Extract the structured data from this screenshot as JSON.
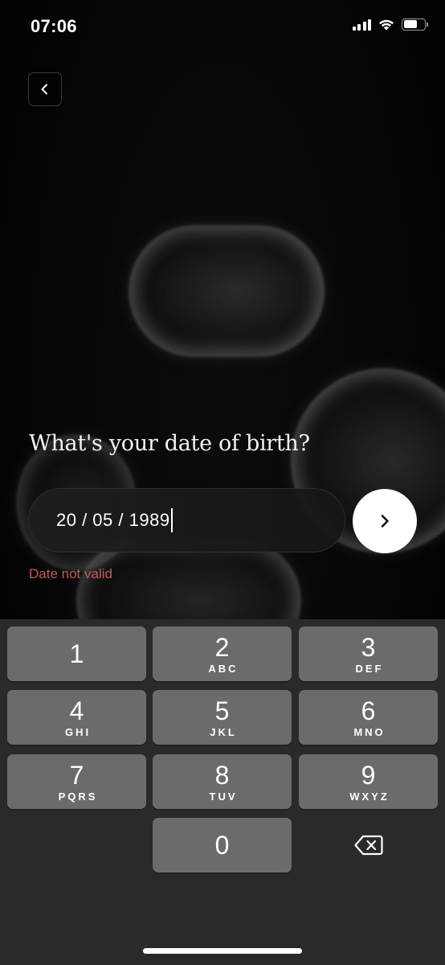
{
  "status_bar": {
    "time": "07:06",
    "battery_level": 0.65
  },
  "icons": {
    "back": "chevron-left-icon",
    "next": "chevron-right-icon",
    "delete": "backspace-icon",
    "signal": "cellular-signal-icon",
    "wifi": "wifi-icon",
    "battery": "battery-icon"
  },
  "form": {
    "question": "What's your date of birth?",
    "date_value": "20 / 05 / 1989",
    "error": "Date not valid"
  },
  "colors": {
    "error": "#c25a5a",
    "key_background": "#6b6b6b",
    "keypad_background": "#2a2a2a"
  },
  "keypad": {
    "keys": [
      {
        "digit": "1",
        "letters": ""
      },
      {
        "digit": "2",
        "letters": "ABC"
      },
      {
        "digit": "3",
        "letters": "DEF"
      },
      {
        "digit": "4",
        "letters": "GHI"
      },
      {
        "digit": "5",
        "letters": "JKL"
      },
      {
        "digit": "6",
        "letters": "MNO"
      },
      {
        "digit": "7",
        "letters": "PQRS"
      },
      {
        "digit": "8",
        "letters": "TUV"
      },
      {
        "digit": "9",
        "letters": "WXYZ"
      },
      {
        "digit": "0",
        "letters": ""
      }
    ]
  }
}
